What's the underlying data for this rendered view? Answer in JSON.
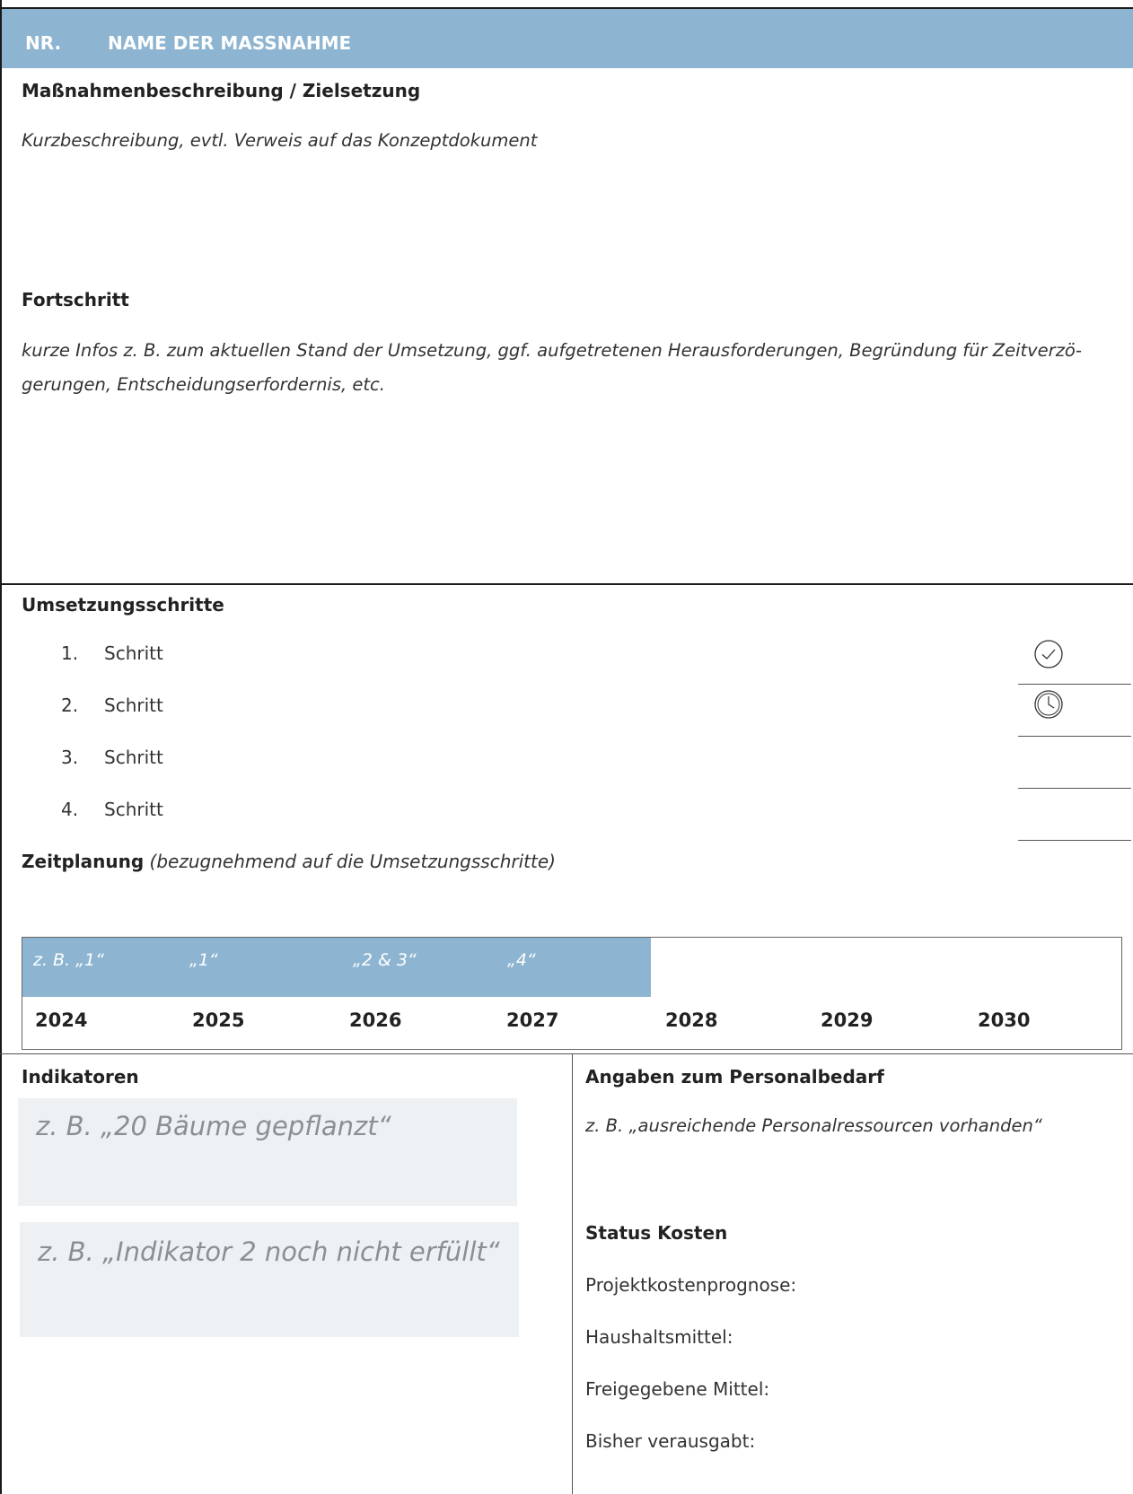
{
  "header": {
    "nr": "NR.",
    "name": "NAME DER MASSNAHME"
  },
  "description": {
    "heading": "Maßnahmenbeschreibung / Zielsetzung",
    "text": "Kurzbeschreibung, evtl. Verweis auf das Konzeptdokument"
  },
  "progress": {
    "heading": "Fortschritt",
    "text_line1": "kurze Infos z. B. zum aktuellen Stand der Umsetzung, ggf. aufgetretenen Herausforderungen, Begründung für Zeitverzö-",
    "text_line2": "gerungen, Entscheidungserfordernis, etc."
  },
  "steps": {
    "heading": "Umsetzungsschritte",
    "items": [
      {
        "num": "1.",
        "label": "Schritt",
        "status_icon": "check-circle-icon"
      },
      {
        "num": "2.",
        "label": "Schritt",
        "status_icon": "clock-icon"
      },
      {
        "num": "3.",
        "label": "Schritt",
        "status_icon": ""
      },
      {
        "num": "4.",
        "label": "Schritt",
        "status_icon": ""
      }
    ]
  },
  "schedule": {
    "heading": "Zeitplanung",
    "subheading": "(bezugnehmend auf die Umsetzungsschritte)",
    "labels": [
      "z. B. „1“",
      "„1“",
      "„2 & 3“",
      "„4“"
    ],
    "years": [
      "2024",
      "2025",
      "2026",
      "2027",
      "2028",
      "2029",
      "2030"
    ]
  },
  "indicators": {
    "heading": "Indikatoren",
    "items": [
      "z. B. „20 Bäume gepflanzt“",
      "z. B. „Indikator 2 noch nicht erfüllt“"
    ]
  },
  "personnel": {
    "heading": "Angaben zum Personalbedarf",
    "text": "z. B. „ausreichende Personalressourcen vorhanden“"
  },
  "costs": {
    "heading": "Status Kosten",
    "lines": [
      "Projektkostenprognose:",
      "Haushaltsmittel:",
      "Freigegebene Mittel:",
      "Bisher verausgabt:"
    ]
  },
  "colors": {
    "accent": "#8db4d0",
    "indicator_bg": "#edf1f4"
  }
}
